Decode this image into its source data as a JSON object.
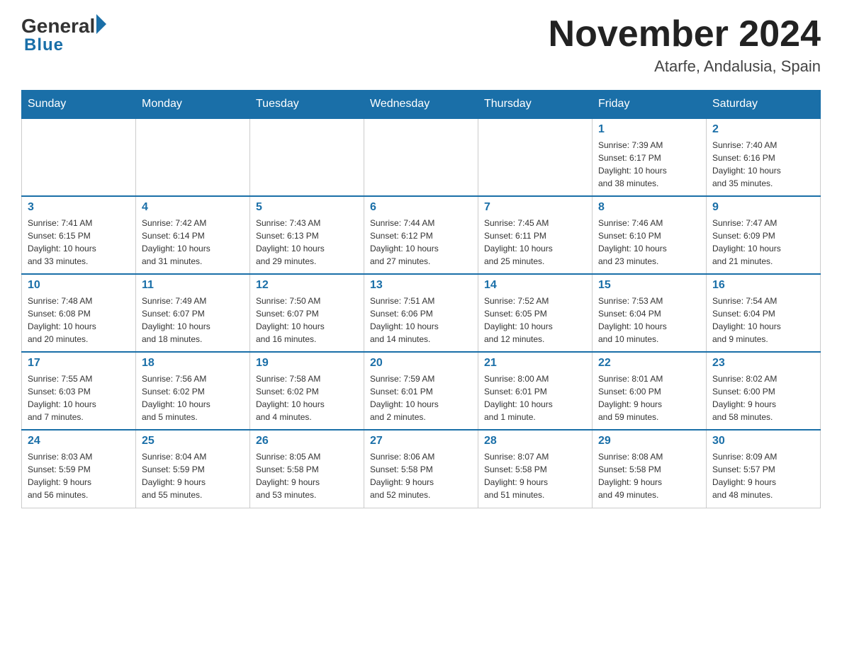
{
  "header": {
    "logo": {
      "general": "General",
      "blue": "Blue"
    },
    "month_year": "November 2024",
    "location": "Atarfe, Andalusia, Spain"
  },
  "weekdays": [
    "Sunday",
    "Monday",
    "Tuesday",
    "Wednesday",
    "Thursday",
    "Friday",
    "Saturday"
  ],
  "weeks": [
    [
      {
        "day": "",
        "info": ""
      },
      {
        "day": "",
        "info": ""
      },
      {
        "day": "",
        "info": ""
      },
      {
        "day": "",
        "info": ""
      },
      {
        "day": "",
        "info": ""
      },
      {
        "day": "1",
        "info": "Sunrise: 7:39 AM\nSunset: 6:17 PM\nDaylight: 10 hours\nand 38 minutes."
      },
      {
        "day": "2",
        "info": "Sunrise: 7:40 AM\nSunset: 6:16 PM\nDaylight: 10 hours\nand 35 minutes."
      }
    ],
    [
      {
        "day": "3",
        "info": "Sunrise: 7:41 AM\nSunset: 6:15 PM\nDaylight: 10 hours\nand 33 minutes."
      },
      {
        "day": "4",
        "info": "Sunrise: 7:42 AM\nSunset: 6:14 PM\nDaylight: 10 hours\nand 31 minutes."
      },
      {
        "day": "5",
        "info": "Sunrise: 7:43 AM\nSunset: 6:13 PM\nDaylight: 10 hours\nand 29 minutes."
      },
      {
        "day": "6",
        "info": "Sunrise: 7:44 AM\nSunset: 6:12 PM\nDaylight: 10 hours\nand 27 minutes."
      },
      {
        "day": "7",
        "info": "Sunrise: 7:45 AM\nSunset: 6:11 PM\nDaylight: 10 hours\nand 25 minutes."
      },
      {
        "day": "8",
        "info": "Sunrise: 7:46 AM\nSunset: 6:10 PM\nDaylight: 10 hours\nand 23 minutes."
      },
      {
        "day": "9",
        "info": "Sunrise: 7:47 AM\nSunset: 6:09 PM\nDaylight: 10 hours\nand 21 minutes."
      }
    ],
    [
      {
        "day": "10",
        "info": "Sunrise: 7:48 AM\nSunset: 6:08 PM\nDaylight: 10 hours\nand 20 minutes."
      },
      {
        "day": "11",
        "info": "Sunrise: 7:49 AM\nSunset: 6:07 PM\nDaylight: 10 hours\nand 18 minutes."
      },
      {
        "day": "12",
        "info": "Sunrise: 7:50 AM\nSunset: 6:07 PM\nDaylight: 10 hours\nand 16 minutes."
      },
      {
        "day": "13",
        "info": "Sunrise: 7:51 AM\nSunset: 6:06 PM\nDaylight: 10 hours\nand 14 minutes."
      },
      {
        "day": "14",
        "info": "Sunrise: 7:52 AM\nSunset: 6:05 PM\nDaylight: 10 hours\nand 12 minutes."
      },
      {
        "day": "15",
        "info": "Sunrise: 7:53 AM\nSunset: 6:04 PM\nDaylight: 10 hours\nand 10 minutes."
      },
      {
        "day": "16",
        "info": "Sunrise: 7:54 AM\nSunset: 6:04 PM\nDaylight: 10 hours\nand 9 minutes."
      }
    ],
    [
      {
        "day": "17",
        "info": "Sunrise: 7:55 AM\nSunset: 6:03 PM\nDaylight: 10 hours\nand 7 minutes."
      },
      {
        "day": "18",
        "info": "Sunrise: 7:56 AM\nSunset: 6:02 PM\nDaylight: 10 hours\nand 5 minutes."
      },
      {
        "day": "19",
        "info": "Sunrise: 7:58 AM\nSunset: 6:02 PM\nDaylight: 10 hours\nand 4 minutes."
      },
      {
        "day": "20",
        "info": "Sunrise: 7:59 AM\nSunset: 6:01 PM\nDaylight: 10 hours\nand 2 minutes."
      },
      {
        "day": "21",
        "info": "Sunrise: 8:00 AM\nSunset: 6:01 PM\nDaylight: 10 hours\nand 1 minute."
      },
      {
        "day": "22",
        "info": "Sunrise: 8:01 AM\nSunset: 6:00 PM\nDaylight: 9 hours\nand 59 minutes."
      },
      {
        "day": "23",
        "info": "Sunrise: 8:02 AM\nSunset: 6:00 PM\nDaylight: 9 hours\nand 58 minutes."
      }
    ],
    [
      {
        "day": "24",
        "info": "Sunrise: 8:03 AM\nSunset: 5:59 PM\nDaylight: 9 hours\nand 56 minutes."
      },
      {
        "day": "25",
        "info": "Sunrise: 8:04 AM\nSunset: 5:59 PM\nDaylight: 9 hours\nand 55 minutes."
      },
      {
        "day": "26",
        "info": "Sunrise: 8:05 AM\nSunset: 5:58 PM\nDaylight: 9 hours\nand 53 minutes."
      },
      {
        "day": "27",
        "info": "Sunrise: 8:06 AM\nSunset: 5:58 PM\nDaylight: 9 hours\nand 52 minutes."
      },
      {
        "day": "28",
        "info": "Sunrise: 8:07 AM\nSunset: 5:58 PM\nDaylight: 9 hours\nand 51 minutes."
      },
      {
        "day": "29",
        "info": "Sunrise: 8:08 AM\nSunset: 5:58 PM\nDaylight: 9 hours\nand 49 minutes."
      },
      {
        "day": "30",
        "info": "Sunrise: 8:09 AM\nSunset: 5:57 PM\nDaylight: 9 hours\nand 48 minutes."
      }
    ]
  ]
}
